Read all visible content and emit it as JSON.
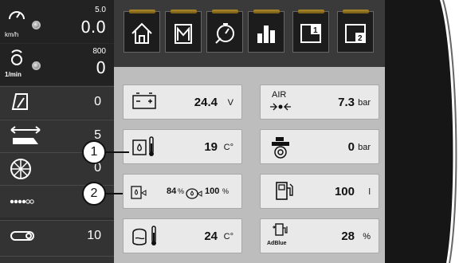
{
  "gauges": {
    "speed": {
      "unit": "km/h",
      "max": "5.0",
      "value": "0.0",
      "icon": "speedometer-icon"
    },
    "engine": {
      "unit": "1/min",
      "max": "800",
      "value": "0",
      "icon": "engine-rpm-icon"
    }
  },
  "left_rows": [
    {
      "icon": "field-area-icon",
      "value": "0"
    },
    {
      "icon": "header-width-icon",
      "value": "5"
    },
    {
      "icon": "wheel-icon",
      "value": "0"
    },
    {
      "icon": "grain-flow-icon",
      "value": ""
    },
    {
      "icon": "chain-conveyor-icon",
      "value": "10"
    }
  ],
  "tabs": [
    {
      "name": "home",
      "icon": "home-icon"
    },
    {
      "name": "memory",
      "icon": "memory-icon"
    },
    {
      "name": "timer",
      "icon": "stopwatch-icon"
    },
    {
      "name": "statistics",
      "icon": "bar-chart-icon"
    },
    {
      "name": "page-1",
      "icon": "page-1-icon",
      "label": "1"
    },
    {
      "name": "page-2",
      "icon": "page-2-icon",
      "label": "2"
    }
  ],
  "cards": {
    "battery": {
      "value": "24.4",
      "unit": "V"
    },
    "air": {
      "label": "AIR",
      "value": "7.3",
      "unit": "bar"
    },
    "coolant_level": {
      "value": "19",
      "unit": "C°"
    },
    "brake_pressure": {
      "value": "0",
      "unit": "bar"
    },
    "fuel_levels": {
      "value1": "84",
      "unit1": "%",
      "value2": "100",
      "unit2": "%"
    },
    "fuel": {
      "value": "100",
      "unit": "l"
    },
    "oil_temp": {
      "value": "24",
      "unit": "C°"
    },
    "adblue": {
      "label": "AdBlue",
      "value": "28",
      "unit": "%"
    }
  },
  "callouts": {
    "first": "1",
    "second": "2"
  }
}
